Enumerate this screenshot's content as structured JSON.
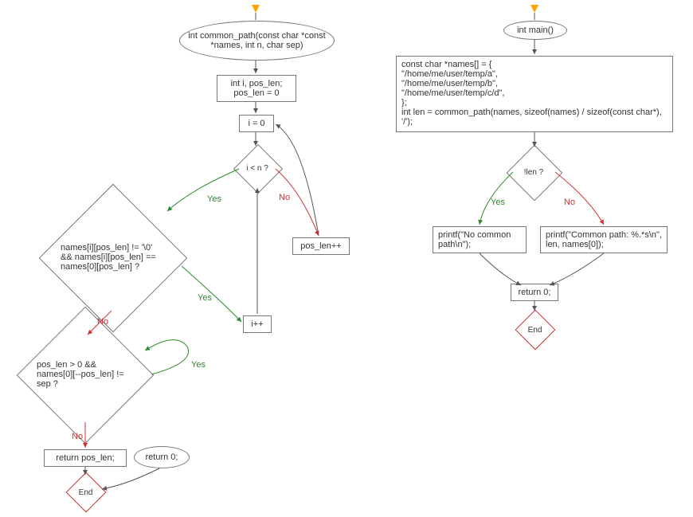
{
  "left_chart": {
    "func_sig": "int common_path(const char *const *names, int n, char sep)",
    "init_vars": "int i, pos_len;\npos_len = 0",
    "i_zero": "i = 0",
    "cond_i_lt_n": "i < n ?",
    "pos_len_pp": "pos_len++",
    "cond_names": "names[i][pos_len] != '\\0' && names[i][pos_len] == names[0][pos_len] ?",
    "i_pp": "i++",
    "cond_poslen_sep": "pos_len > 0 && names[0][--pos_len] != sep ?",
    "return_poslen": "return pos_len;",
    "return_zero": "return 0;",
    "end": "End"
  },
  "right_chart": {
    "main_sig": "int main()",
    "main_body": "const char *names[] = {\n \"/home/me/user/temp/a\",\n \"/home/me/user/temp/b\",\n \"/home/me/user/temp/c/d\",\n};\nint len = common_path(names, sizeof(names) / sizeof(const char*), '/');",
    "cond_notlen": "!len ?",
    "printf_no": "printf(\"No common path\\n\");",
    "printf_common": "printf(\"Common path: %.*s\\n\", len, names[0]);",
    "return_zero": "return 0;",
    "end": "End"
  },
  "labels": {
    "yes": "Yes",
    "no": "No"
  }
}
